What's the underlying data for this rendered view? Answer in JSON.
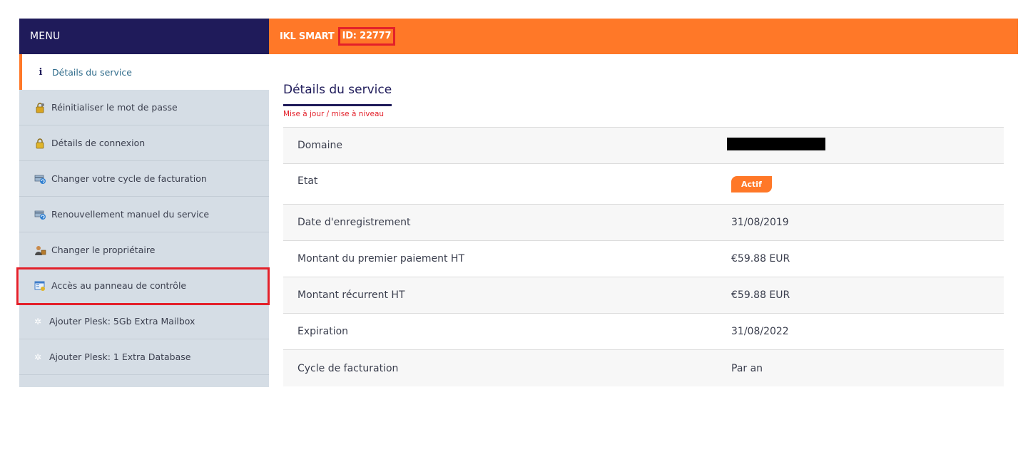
{
  "sidebar": {
    "header": "MENU",
    "items": [
      {
        "label": "Détails du service",
        "icon": "info-icon"
      },
      {
        "label": "Réinitialiser le mot de passe",
        "icon": "key-lock-icon"
      },
      {
        "label": "Détails de connexion",
        "icon": "lock-icon"
      },
      {
        "label": "Changer votre cycle de facturation",
        "icon": "billing-cycle-icon"
      },
      {
        "label": "Renouvellement manuel du service",
        "icon": "renew-icon"
      },
      {
        "label": "Changer le propriétaire",
        "icon": "owner-icon"
      },
      {
        "label": "Accès au panneau de contrôle",
        "icon": "control-panel-icon"
      },
      {
        "label": "Ajouter Plesk: 5Gb Extra Mailbox",
        "icon": "gear-icon"
      },
      {
        "label": "Ajouter Plesk: 1 Extra Database",
        "icon": "gear-icon"
      }
    ]
  },
  "topbar": {
    "product": "IKL SMART",
    "service_id": "ID: 22777"
  },
  "main": {
    "title": "Détails du service",
    "upgrade_link": "Mise à jour / mise à niveau",
    "rows": [
      {
        "label": "Domaine",
        "value": ""
      },
      {
        "label": "Etat",
        "value": "Actif"
      },
      {
        "label": "Date d'enregistrement",
        "value": "31/08/2019"
      },
      {
        "label": "Montant du premier paiement HT",
        "value": "€59.88 EUR"
      },
      {
        "label": "Montant récurrent HT",
        "value": "€59.88 EUR"
      },
      {
        "label": "Expiration",
        "value": "31/08/2022"
      },
      {
        "label": "Cycle de facturation",
        "value": "Par an"
      }
    ]
  },
  "colors": {
    "navy": "#1f1b5a",
    "orange": "#ff7828",
    "highlight_red": "#e3202a",
    "sidebar_bg": "#d5dde5"
  }
}
